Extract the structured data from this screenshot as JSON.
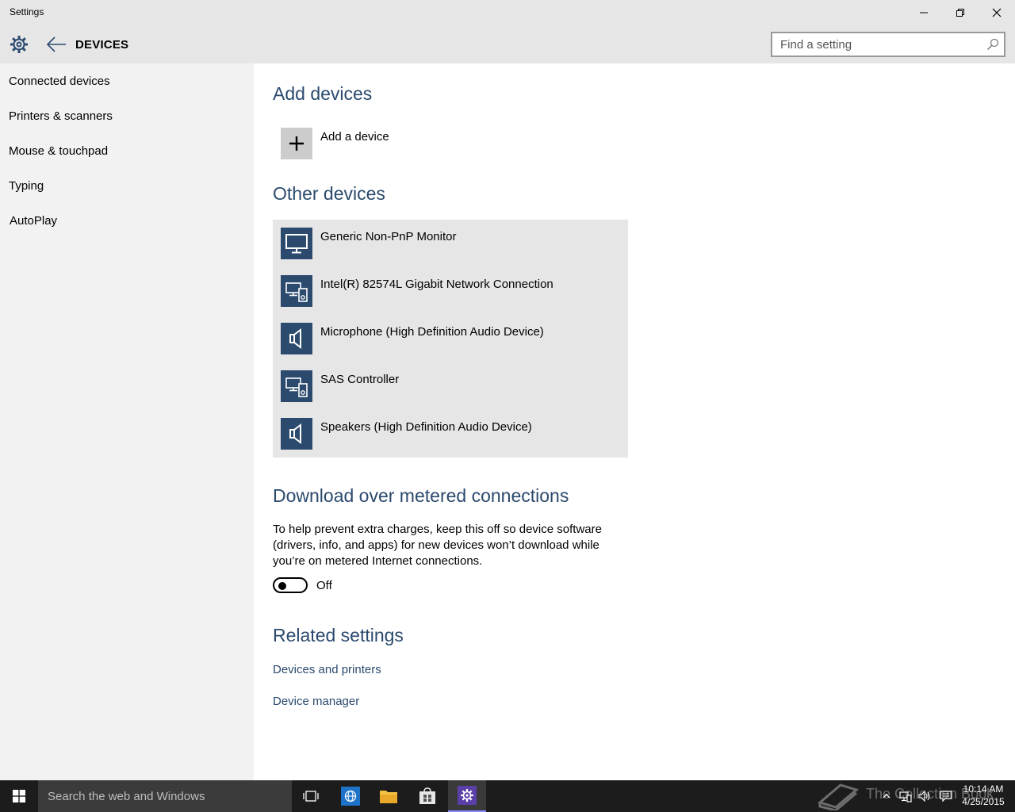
{
  "window": {
    "title": "Settings"
  },
  "header": {
    "section_title": "DEVICES",
    "search_placeholder": "Find a setting"
  },
  "sidebar": {
    "items": [
      {
        "label": "Connected devices"
      },
      {
        "label": "Printers & scanners"
      },
      {
        "label": "Mouse & touchpad"
      },
      {
        "label": "Typing"
      },
      {
        "label": "AutoPlay"
      }
    ]
  },
  "main": {
    "add_devices": {
      "heading": "Add devices",
      "add_label": "Add a device"
    },
    "other_devices": {
      "heading": "Other devices",
      "devices": [
        {
          "name": "Generic Non-PnP Monitor",
          "icon": "monitor-icon"
        },
        {
          "name": "Intel(R) 82574L Gigabit Network Connection",
          "icon": "generic-device-icon"
        },
        {
          "name": "Microphone (High Definition Audio Device)",
          "icon": "speaker-icon"
        },
        {
          "name": "SAS Controller",
          "icon": "generic-device-icon"
        },
        {
          "name": "Speakers (High Definition Audio Device)",
          "icon": "speaker-icon"
        }
      ]
    },
    "metered": {
      "heading": "Download over metered connections",
      "description": "To help prevent extra charges, keep this off so device software (drivers, info, and apps) for new devices won’t download while you’re on metered Internet connections.",
      "toggle_state": "Off"
    },
    "related": {
      "heading": "Related settings",
      "links": [
        {
          "label": "Devices and printers"
        },
        {
          "label": "Device manager"
        }
      ]
    }
  },
  "taskbar": {
    "search_placeholder": "Search the web and Windows",
    "watermark": "The Collection Book",
    "time": "10:14 AM",
    "date": "4/25/2015"
  },
  "colors": {
    "accent": "#2b4a6e",
    "header_bg": "#e6e6e6",
    "sidebar_bg": "#f2f2f2",
    "taskbar_bg": "#1c1c1c"
  }
}
